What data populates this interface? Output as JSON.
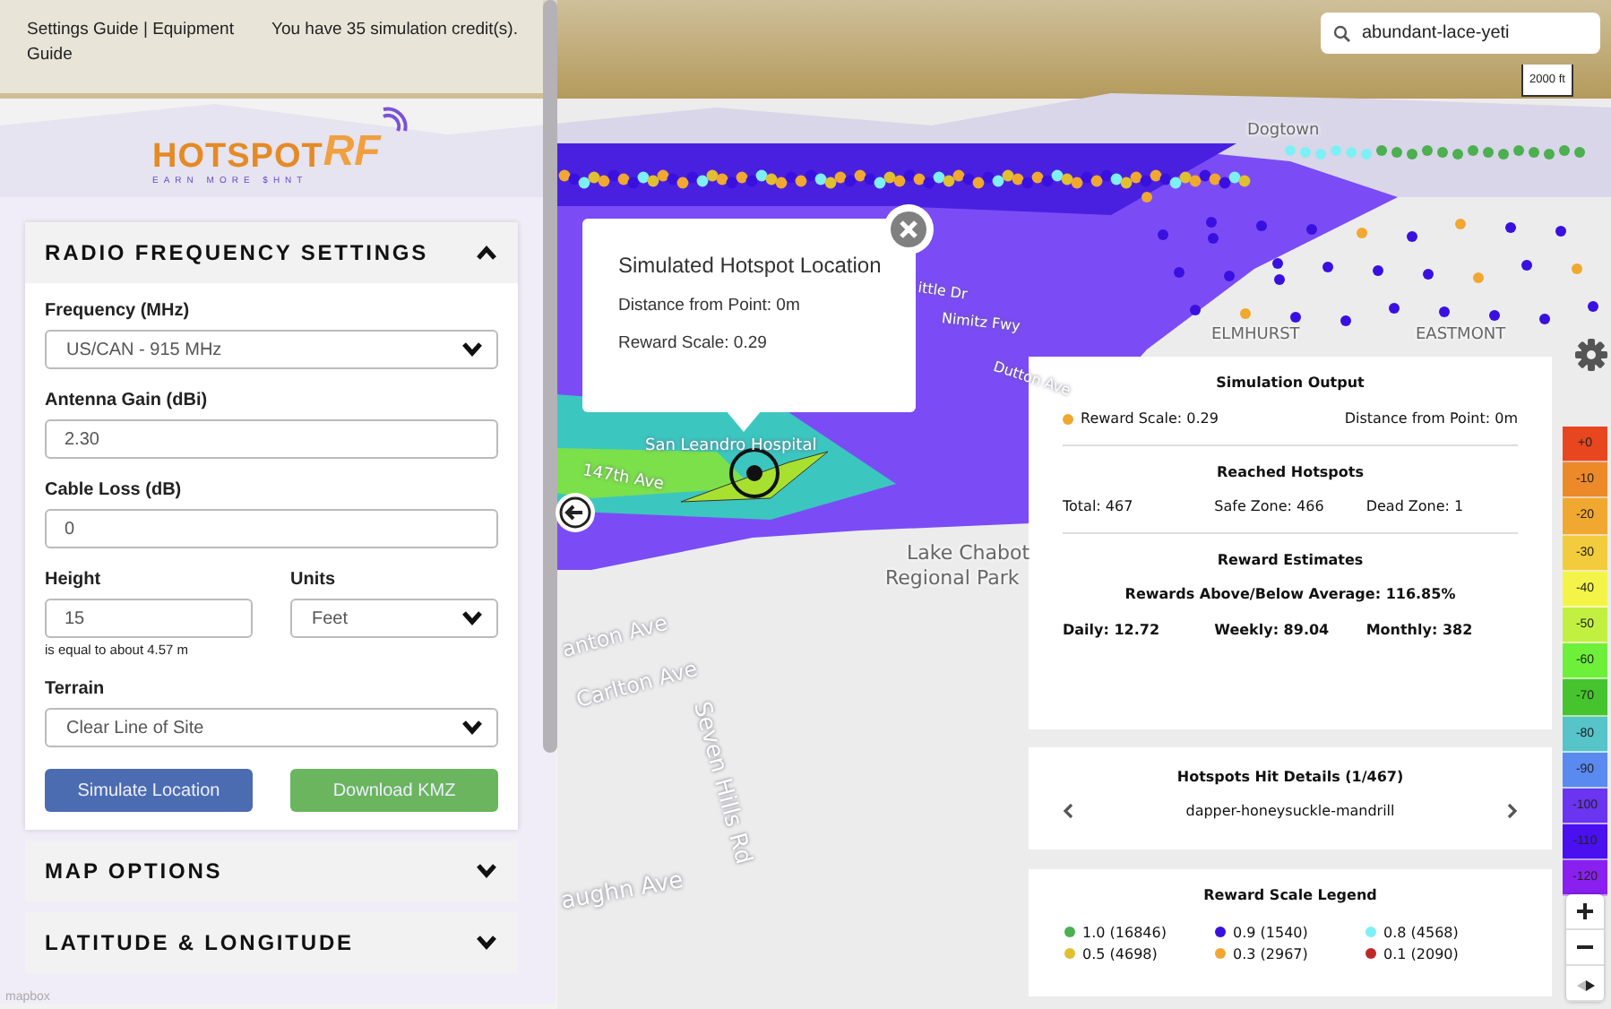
{
  "header": {
    "links": "Settings Guide | Equipment Guide",
    "credits": "You have 35 simulation credit(s)."
  },
  "logo": {
    "name": "HOTSPOT",
    "suffix": "RF",
    "tagline": "EARN MORE $HNT"
  },
  "panels": [
    {
      "title": "RADIO FREQUENCY SETTINGS",
      "expanded": true
    },
    {
      "title": "MAP OPTIONS",
      "expanded": false
    },
    {
      "title": "LATITUDE & LONGITUDE",
      "expanded": false
    }
  ],
  "rf_settings": {
    "frequency": {
      "label": "Frequency (MHz)",
      "value": "US/CAN - 915 MHz"
    },
    "antenna_gain": {
      "label": "Antenna Gain (dBi)",
      "value": "2.30"
    },
    "cable_loss": {
      "label": "Cable Loss (dB)",
      "value": "0"
    },
    "height": {
      "label": "Height",
      "value": "15",
      "note": "is equal to about 4.57 m"
    },
    "units": {
      "label": "Units",
      "value": "Feet"
    },
    "terrain": {
      "label": "Terrain",
      "value": "Clear Line of Site"
    },
    "buttons": [
      {
        "label": "Simulate Location",
        "kind": "primary"
      },
      {
        "label": "Download KMZ",
        "kind": "success"
      }
    ]
  },
  "search": {
    "value": "abundant-lace-yeti"
  },
  "scale_bar": "2000 ft",
  "map_labels": [
    "Dogtown",
    "ELMHURST",
    "EASTMONT",
    "ittle Dr",
    "Nimitz Fwy",
    "Dutton Ave",
    "San Leandro Hospital",
    "147th Ave",
    "Lake Chabot",
    "Regional Park",
    "anton Ave",
    "Carlton Ave",
    "Seven Hills Rd",
    "aughn Ave"
  ],
  "popup": {
    "title": "Simulated Hotspot Location",
    "lines": [
      "Distance from Point: 0m",
      "Reward Scale: 0.29"
    ]
  },
  "simulation_output": {
    "title": "Simulation Output",
    "reward_scale": {
      "text": "Reward Scale: 0.29",
      "color": "#f0a830"
    },
    "distance": "Distance from Point: 0m",
    "reached": {
      "title": "Reached Hotspots",
      "items": [
        "Total: 467",
        "Safe Zone: 466",
        "Dead Zone: 1"
      ]
    },
    "estimates": {
      "title": "Reward Estimates",
      "average": "Rewards Above/Below Average: 116.85%",
      "items": [
        "Daily: 12.72",
        "Weekly: 89.04",
        "Monthly: 382"
      ]
    }
  },
  "hits": {
    "title": "Hotspots Hit Details (1/467)",
    "hotspot": "dapper-honeysuckle-mandrill"
  },
  "legend": {
    "title": "Reward Scale Legend",
    "items": [
      {
        "label": "1.0 (16846)",
        "color": "#4caf50"
      },
      {
        "label": "0.9 (1540)",
        "color": "#3a10e0"
      },
      {
        "label": "0.8 (4568)",
        "color": "#7ef0f5"
      },
      {
        "label": "0.5 (4698)",
        "color": "#e0c030"
      },
      {
        "label": "0.3 (2967)",
        "color": "#f0a830"
      },
      {
        "label": "0.1 (2090)",
        "color": "#c02828"
      }
    ]
  },
  "signal_scale": [
    {
      "label": "+0",
      "color": "#e8461e"
    },
    {
      "label": "-10",
      "color": "#ec8a2a"
    },
    {
      "label": "-20",
      "color": "#f0a830"
    },
    {
      "label": "-30",
      "color": "#f2cc3c"
    },
    {
      "label": "-40",
      "color": "#f4f448"
    },
    {
      "label": "-50",
      "color": "#c2f040"
    },
    {
      "label": "-60",
      "color": "#6ef03a"
    },
    {
      "label": "-70",
      "color": "#46c42e"
    },
    {
      "label": "-80",
      "color": "#56c4c8"
    },
    {
      "label": "-90",
      "color": "#5a8af0"
    },
    {
      "label": "-100",
      "color": "#6a34f0"
    },
    {
      "label": "-110",
      "color": "#4a10f0"
    },
    {
      "label": "-120",
      "color": "#8a20f0"
    }
  ],
  "attribution": "mapbox"
}
